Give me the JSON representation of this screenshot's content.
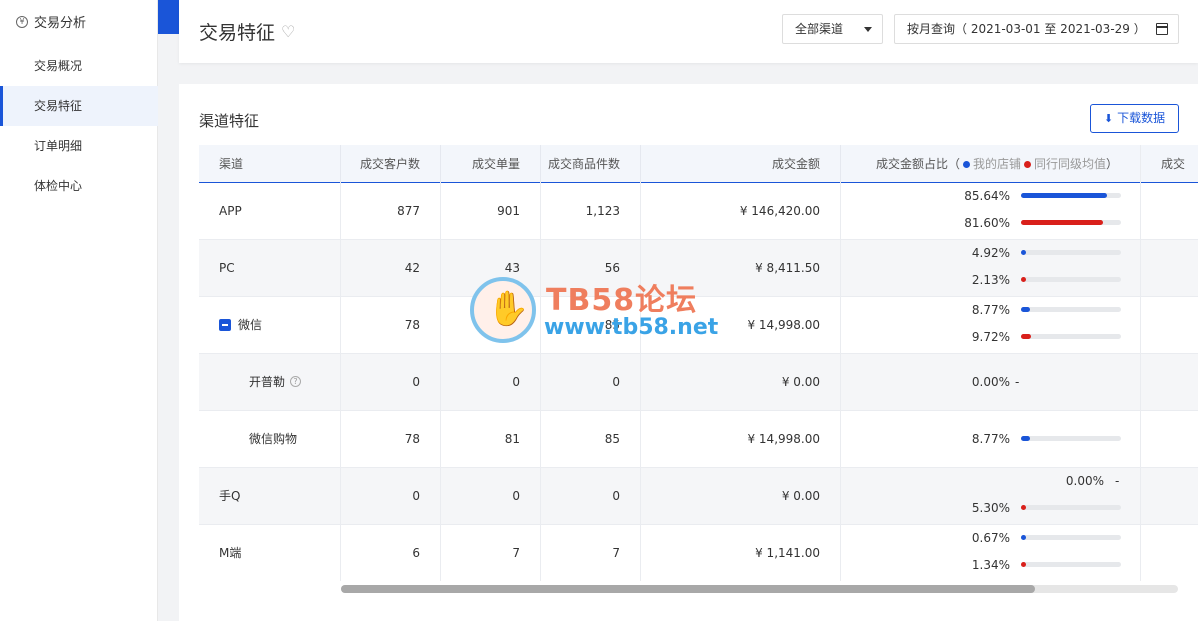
{
  "sidebar": {
    "section_title": "交易分析",
    "section_icon": "yen-circle-icon",
    "items": [
      {
        "label": "交易概况",
        "active": false
      },
      {
        "label": "交易特征",
        "active": true
      },
      {
        "label": "订单明细",
        "active": false
      },
      {
        "label": "体检中心",
        "active": false
      }
    ]
  },
  "header": {
    "title": "交易特征",
    "favorite_icon": "heart-icon",
    "channel_select": "全部渠道",
    "date_range": "按月查询（ 2021-03-01 至 2021-03-29 ）"
  },
  "card": {
    "title": "渠道特征",
    "download_label": "下载数据"
  },
  "table": {
    "headers": {
      "channel": "渠道",
      "customers": "成交客户数",
      "orders": "成交单量",
      "items": "成交商品件数",
      "amount": "成交金额",
      "share": "成交金额占比（",
      "mine": "我的店铺",
      "peer": "同行同级均值",
      "share_close": "）",
      "extra": "成交"
    },
    "rows": [
      {
        "channel": "APP",
        "customers": "877",
        "orders": "901",
        "items": "1,123",
        "amount": "¥ 146,420.00",
        "mine_pct": "85.64%",
        "mine_val": 85.64,
        "peer_pct": "81.60%",
        "peer_val": 81.6
      },
      {
        "channel": "PC",
        "customers": "42",
        "orders": "43",
        "items": "56",
        "amount": "¥ 8,411.50",
        "mine_pct": "4.92%",
        "mine_val": 4.92,
        "peer_pct": "2.13%",
        "peer_val": 2.13
      },
      {
        "channel": "微信",
        "customers": "78",
        "orders": "81",
        "items": "85",
        "amount": "¥ 14,998.00",
        "mine_pct": "8.77%",
        "mine_val": 8.77,
        "peer_pct": "9.72%",
        "peer_val": 9.72
      },
      {
        "channel": "开普勒",
        "customers": "0",
        "orders": "0",
        "items": "0",
        "amount": "¥ 0.00",
        "mine_pct": "0.00%",
        "dash": "-"
      },
      {
        "channel": "微信购物",
        "customers": "78",
        "orders": "81",
        "items": "85",
        "amount": "¥ 14,998.00",
        "mine_pct": "8.77%",
        "mine_val": 8.77
      },
      {
        "channel": "手Q",
        "customers": "0",
        "orders": "0",
        "items": "0",
        "amount": "¥ 0.00",
        "mine_pct": "0.00%",
        "dash": "-",
        "peer_pct": "5.30%",
        "peer_val": 5.3
      },
      {
        "channel": "M端",
        "customers": "6",
        "orders": "7",
        "items": "7",
        "amount": "¥ 1,141.00",
        "mine_pct": "0.67%",
        "mine_val": 0.67,
        "peer_pct": "1.34%",
        "peer_val": 1.34
      }
    ]
  },
  "colors": {
    "accent": "#1a55d8",
    "mine": "#1a55d8",
    "peer": "#d9201b"
  },
  "watermark": {
    "title": "TB58论坛",
    "url": "www.tb58.net"
  }
}
